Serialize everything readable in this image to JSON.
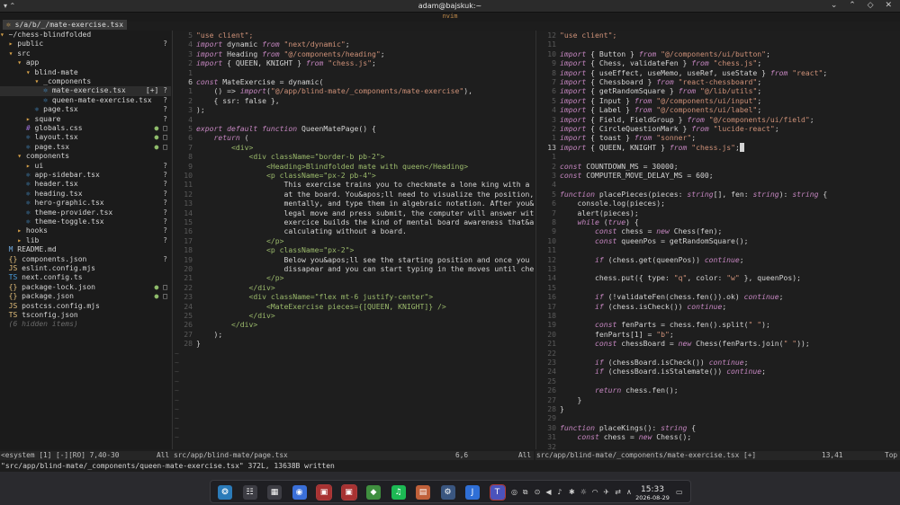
{
  "window": {
    "title": "adam@bajskuk:~",
    "left_controls": "▾ ⌃",
    "right_controls": "⌄ ⌃ ◇ ✕"
  },
  "nvim": {
    "label": "nvim",
    "active_tab": "s/a/b/_/mate-exercise.tsx",
    "tab_icon": "⚛"
  },
  "tree": {
    "rows": [
      {
        "indent": "",
        "icon": "▾",
        "kind": "dir",
        "name": "~/chess-blindfolded",
        "status": ""
      },
      {
        "indent": "  ",
        "icon": "▸",
        "kind": "dir",
        "name": "public",
        "status": "?"
      },
      {
        "indent": "  ",
        "icon": "▾",
        "kind": "dir",
        "name": "src",
        "status": ""
      },
      {
        "indent": "    ",
        "icon": "▾",
        "kind": "dir",
        "name": "app",
        "status": ""
      },
      {
        "indent": "      ",
        "icon": "▾",
        "kind": "dir",
        "name": "blind-mate",
        "status": ""
      },
      {
        "indent": "        ",
        "icon": "▾",
        "kind": "dir",
        "name": "_components",
        "status": ""
      },
      {
        "indent": "          ",
        "icon": "⚛",
        "kind": "ts",
        "name": "mate-exercise.tsx",
        "status": "[+] ?",
        "selected": true
      },
      {
        "indent": "          ",
        "icon": "⚛",
        "kind": "ts",
        "name": "queen-mate-exercise.tsx",
        "status": "?"
      },
      {
        "indent": "        ",
        "icon": "⚛",
        "kind": "ts",
        "name": "page.tsx",
        "status": "?"
      },
      {
        "indent": "      ",
        "icon": "▸",
        "kind": "dir",
        "name": "square",
        "status": "?"
      },
      {
        "indent": "      ",
        "icon": "#",
        "kind": "css",
        "name": "globals.css",
        "status": "● □"
      },
      {
        "indent": "      ",
        "icon": "⚛",
        "kind": "ts",
        "name": "layout.tsx",
        "status": "● □"
      },
      {
        "indent": "      ",
        "icon": "⚛",
        "kind": "ts",
        "name": "page.tsx",
        "status": "● □"
      },
      {
        "indent": "    ",
        "icon": "▾",
        "kind": "dir",
        "name": "components",
        "status": ""
      },
      {
        "indent": "      ",
        "icon": "▸",
        "kind": "dir",
        "name": "ui",
        "status": "?"
      },
      {
        "indent": "      ",
        "icon": "⚛",
        "kind": "ts",
        "name": "app-sidebar.tsx",
        "status": "?"
      },
      {
        "indent": "      ",
        "icon": "⚛",
        "kind": "ts",
        "name": "header.tsx",
        "status": "?"
      },
      {
        "indent": "      ",
        "icon": "⚛",
        "kind": "ts",
        "name": "heading.tsx",
        "status": "?"
      },
      {
        "indent": "      ",
        "icon": "⚛",
        "kind": "ts",
        "name": "hero-graphic.tsx",
        "status": "?"
      },
      {
        "indent": "      ",
        "icon": "⚛",
        "kind": "ts",
        "name": "theme-provider.tsx",
        "status": "?"
      },
      {
        "indent": "      ",
        "icon": "⚛",
        "kind": "ts",
        "name": "theme-toggle.tsx",
        "status": "?"
      },
      {
        "indent": "    ",
        "icon": "▸",
        "kind": "dir",
        "name": "hooks",
        "status": "?"
      },
      {
        "indent": "    ",
        "icon": "▸",
        "kind": "dir",
        "name": "lib",
        "status": "?"
      },
      {
        "indent": "  ",
        "icon": "M",
        "kind": "md",
        "name": "README.md",
        "status": ""
      },
      {
        "indent": "  ",
        "icon": "{}",
        "kind": "json",
        "name": "components.json",
        "status": "?"
      },
      {
        "indent": "  ",
        "icon": "JS",
        "kind": "js",
        "name": "eslint.config.mjs",
        "status": ""
      },
      {
        "indent": "  ",
        "icon": "TS",
        "kind": "ts",
        "name": "next.config.ts",
        "status": ""
      },
      {
        "indent": "  ",
        "icon": "{}",
        "kind": "json",
        "name": "package-lock.json",
        "status": "● □"
      },
      {
        "indent": "  ",
        "icon": "{}",
        "kind": "json",
        "name": "package.json",
        "status": "● □"
      },
      {
        "indent": "  ",
        "icon": "JS",
        "kind": "js",
        "name": "postcss.config.mjs",
        "status": ""
      },
      {
        "indent": "  ",
        "icon": "TS",
        "kind": "json",
        "name": "tsconfig.json",
        "status": ""
      },
      {
        "indent": "  ",
        "icon": "",
        "kind": "hidden",
        "name": "(6 hidden items)",
        "status": ""
      }
    ]
  },
  "left_pane": {
    "lines": [
      {
        "n": "5",
        "t": "\"use client\";",
        "c": "#ce9178"
      },
      {
        "n": "4",
        "t": "import dynamic from \"next/dynamic\";",
        "c": ""
      },
      {
        "n": "3",
        "t": "import Heading from \"@/components/heading\";",
        "c": ""
      },
      {
        "n": "2",
        "t": "import { QUEEN, KNIGHT } from \"chess.js\";",
        "c": ""
      },
      {
        "n": "1",
        "t": "",
        "c": ""
      },
      {
        "n": "6",
        "t": "const MateExercise = dynamic(",
        "c": "",
        "cur": true
      },
      {
        "n": "1",
        "t": "    () => import(\"@/app/blind-mate/_components/mate-exercise\"),",
        "c": ""
      },
      {
        "n": "2",
        "t": "    { ssr: false },",
        "c": ""
      },
      {
        "n": "3",
        "t": ");",
        "c": ""
      },
      {
        "n": "4",
        "t": "",
        "c": ""
      },
      {
        "n": "5",
        "t": "export default function QueenMatePage() {",
        "c": ""
      },
      {
        "n": "6",
        "t": "    return (",
        "c": ""
      },
      {
        "n": "7",
        "t": "        <div>",
        "c": "#9cbb6c"
      },
      {
        "n": "8",
        "t": "            <div className=\"border-b pb-2\">",
        "c": "#9cbb6c"
      },
      {
        "n": "9",
        "t": "                <Heading>Blindfolded mate with queen</Heading>",
        "c": "#9cbb6c"
      },
      {
        "n": "10",
        "t": "                <p className=\"px-2 pb-4\">",
        "c": "#9cbb6c"
      },
      {
        "n": "11",
        "t": "                    This exercise trains you to checkmate a lone king with a qu",
        "c": ""
      },
      {
        "n": "12",
        "t": "                    at the board. You&apos;ll need to visualize the position, c",
        "c": ""
      },
      {
        "n": "13",
        "t": "                    mentally, and type them in algebraic notation. After you&ap",
        "c": ""
      },
      {
        "n": "14",
        "t": "                    legal move and press submit, the computer will answer with",
        "c": ""
      },
      {
        "n": "15",
        "t": "                    exercice builds the kind of mental board awareness that&apos",
        "c": ""
      },
      {
        "n": "16",
        "t": "                    calculating without a board.",
        "c": ""
      },
      {
        "n": "17",
        "t": "                </p>",
        "c": "#9cbb6c"
      },
      {
        "n": "18",
        "t": "                <p className=\"px-2\">",
        "c": "#9cbb6c"
      },
      {
        "n": "19",
        "t": "                    Below you&apos;ll see the starting position and once you pr",
        "c": ""
      },
      {
        "n": "20",
        "t": "                    dissapear and you can start typing in the moves until check",
        "c": ""
      },
      {
        "n": "21",
        "t": "                </p>",
        "c": "#9cbb6c"
      },
      {
        "n": "22",
        "t": "            </div>",
        "c": "#9cbb6c"
      },
      {
        "n": "23",
        "t": "            <div className=\"flex mt-6 justify-center\">",
        "c": "#9cbb6c"
      },
      {
        "n": "24",
        "t": "                <MateExercise pieces={[QUEEN, KNIGHT]} />",
        "c": "#9cbb6c"
      },
      {
        "n": "25",
        "t": "            </div>",
        "c": "#9cbb6c"
      },
      {
        "n": "26",
        "t": "        </div>",
        "c": "#9cbb6c"
      },
      {
        "n": "27",
        "t": "    );",
        "c": ""
      },
      {
        "n": "28",
        "t": "}",
        "c": ""
      }
    ],
    "tildes": 10
  },
  "right_pane": {
    "lines": [
      {
        "n": "12",
        "t": "\"use client\";",
        "c": "#ce9178"
      },
      {
        "n": "11",
        "t": "",
        "c": ""
      },
      {
        "n": "10",
        "t": "import { Button } from \"@/components/ui/button\";",
        "c": ""
      },
      {
        "n": "9",
        "t": "import { Chess, validateFen } from \"chess.js\";",
        "c": ""
      },
      {
        "n": "8",
        "t": "import { useEffect, useMemo, useRef, useState } from \"react\";",
        "c": ""
      },
      {
        "n": "7",
        "t": "import { Chessboard } from \"react-chessboard\";",
        "c": ""
      },
      {
        "n": "6",
        "t": "import { getRandomSquare } from \"@/lib/utils\";",
        "c": ""
      },
      {
        "n": "5",
        "t": "import { Input } from \"@/components/ui/input\";",
        "c": ""
      },
      {
        "n": "4",
        "t": "import { Label } from \"@/components/ui/label\";",
        "c": ""
      },
      {
        "n": "3",
        "t": "import { Field, FieldGroup } from \"@/components/ui/field\";",
        "c": ""
      },
      {
        "n": "2",
        "t": "import { CircleQuestionMark } from \"lucide-react\";",
        "c": ""
      },
      {
        "n": "1",
        "t": "import { toast } from \"sonner\";",
        "c": ""
      },
      {
        "n": "13",
        "t": "import { QUEEN, KNIGHT } from \"chess.js\";",
        "c": "",
        "cur": true,
        "cursor": true
      },
      {
        "n": "1",
        "t": "",
        "c": ""
      },
      {
        "n": "2",
        "t": "const COUNTDOWN_MS = 30000;",
        "c": ""
      },
      {
        "n": "3",
        "t": "const COMPUTER_MOVE_DELAY_MS = 600;",
        "c": ""
      },
      {
        "n": "4",
        "t": "",
        "c": ""
      },
      {
        "n": "5",
        "t": "function placePieces(pieces: string[], fen: string): string {",
        "c": ""
      },
      {
        "n": "6",
        "t": "    console.log(pieces);",
        "c": ""
      },
      {
        "n": "7",
        "t": "    alert(pieces);",
        "c": ""
      },
      {
        "n": "8",
        "t": "    while (true) {",
        "c": ""
      },
      {
        "n": "9",
        "t": "        const chess = new Chess(fen);",
        "c": ""
      },
      {
        "n": "10",
        "t": "        const queenPos = getRandomSquare();",
        "c": ""
      },
      {
        "n": "11",
        "t": "",
        "c": ""
      },
      {
        "n": "12",
        "t": "        if (chess.get(queenPos)) continue;",
        "c": ""
      },
      {
        "n": "13",
        "t": "",
        "c": ""
      },
      {
        "n": "14",
        "t": "        chess.put({ type: \"q\", color: \"w\" }, queenPos);",
        "c": ""
      },
      {
        "n": "15",
        "t": "",
        "c": ""
      },
      {
        "n": "16",
        "t": "        if (!validateFen(chess.fen()).ok) continue;",
        "c": ""
      },
      {
        "n": "17",
        "t": "        if (chess.isCheck()) continue;",
        "c": ""
      },
      {
        "n": "18",
        "t": "",
        "c": ""
      },
      {
        "n": "19",
        "t": "        const fenParts = chess.fen().split(\" \");",
        "c": ""
      },
      {
        "n": "20",
        "t": "        fenParts[1] = \"b\";",
        "c": ""
      },
      {
        "n": "21",
        "t": "        const chessBoard = new Chess(fenParts.join(\" \"));",
        "c": ""
      },
      {
        "n": "22",
        "t": "",
        "c": ""
      },
      {
        "n": "23",
        "t": "        if (chessBoard.isCheck()) continue;",
        "c": ""
      },
      {
        "n": "24",
        "t": "        if (chessBoard.isStalemate()) continue;",
        "c": ""
      },
      {
        "n": "25",
        "t": "",
        "c": ""
      },
      {
        "n": "26",
        "t": "        return chess.fen();",
        "c": ""
      },
      {
        "n": "27",
        "t": "    }",
        "c": ""
      },
      {
        "n": "28",
        "t": "}",
        "c": ""
      },
      {
        "n": "29",
        "t": "",
        "c": ""
      },
      {
        "n": "30",
        "t": "function placeKings(): string {",
        "c": ""
      },
      {
        "n": "31",
        "t": "    const chess = new Chess();",
        "c": ""
      },
      {
        "n": "32",
        "t": "",
        "c": ""
      }
    ]
  },
  "statusline": {
    "left_tree": "<esystem [1] [-][RO] 7,40-30",
    "left_tree_pos": "All",
    "left_file": "src/app/blind-mate/page.tsx",
    "left_pos": "6,6",
    "left_scroll": "All",
    "right_file": "src/app/blind-mate/_components/mate-exercise.tsx [+]",
    "right_pos": "13,41",
    "right_scroll": "Top"
  },
  "cmdline": "\"src/app/blind-mate/_components/queen-mate-exercise.tsx\" 372L, 13638B written",
  "taskbar": {
    "apps": [
      {
        "name": "kde-icon",
        "glyph": "❂",
        "color": "#2b7bb9"
      },
      {
        "name": "settings-icon",
        "glyph": "☷",
        "color": "#3d3d44"
      },
      {
        "name": "store-icon",
        "glyph": "▦",
        "color": "#3d3d44"
      },
      {
        "name": "chrome-icon",
        "glyph": "◉",
        "color": "#3a6fd8"
      },
      {
        "name": "terminal-icon",
        "glyph": "▣",
        "color": "#a83232",
        "active": true
      },
      {
        "name": "terminal-2-icon",
        "glyph": "▣",
        "color": "#a83232",
        "active": true
      },
      {
        "name": "gamepad-icon",
        "glyph": "◆",
        "color": "#3f8f3f"
      },
      {
        "name": "spotify-icon",
        "glyph": "♫",
        "color": "#1db954"
      },
      {
        "name": "files-icon",
        "glyph": "▤",
        "color": "#c0603a"
      },
      {
        "name": "steam-icon",
        "glyph": "⚙",
        "color": "#3a5680"
      },
      {
        "name": "j-app-icon",
        "glyph": "J",
        "color": "#2f6fd6"
      },
      {
        "name": "teams-icon",
        "glyph": "T",
        "color": "#4b53bc",
        "active": true
      }
    ],
    "tray": [
      "◎",
      "⧉",
      "⊙",
      "◀",
      "♪",
      "✱",
      "☼",
      "◠",
      "✈",
      "⇄",
      "∧"
    ],
    "time": "15:33",
    "date": "2026-08-29"
  }
}
